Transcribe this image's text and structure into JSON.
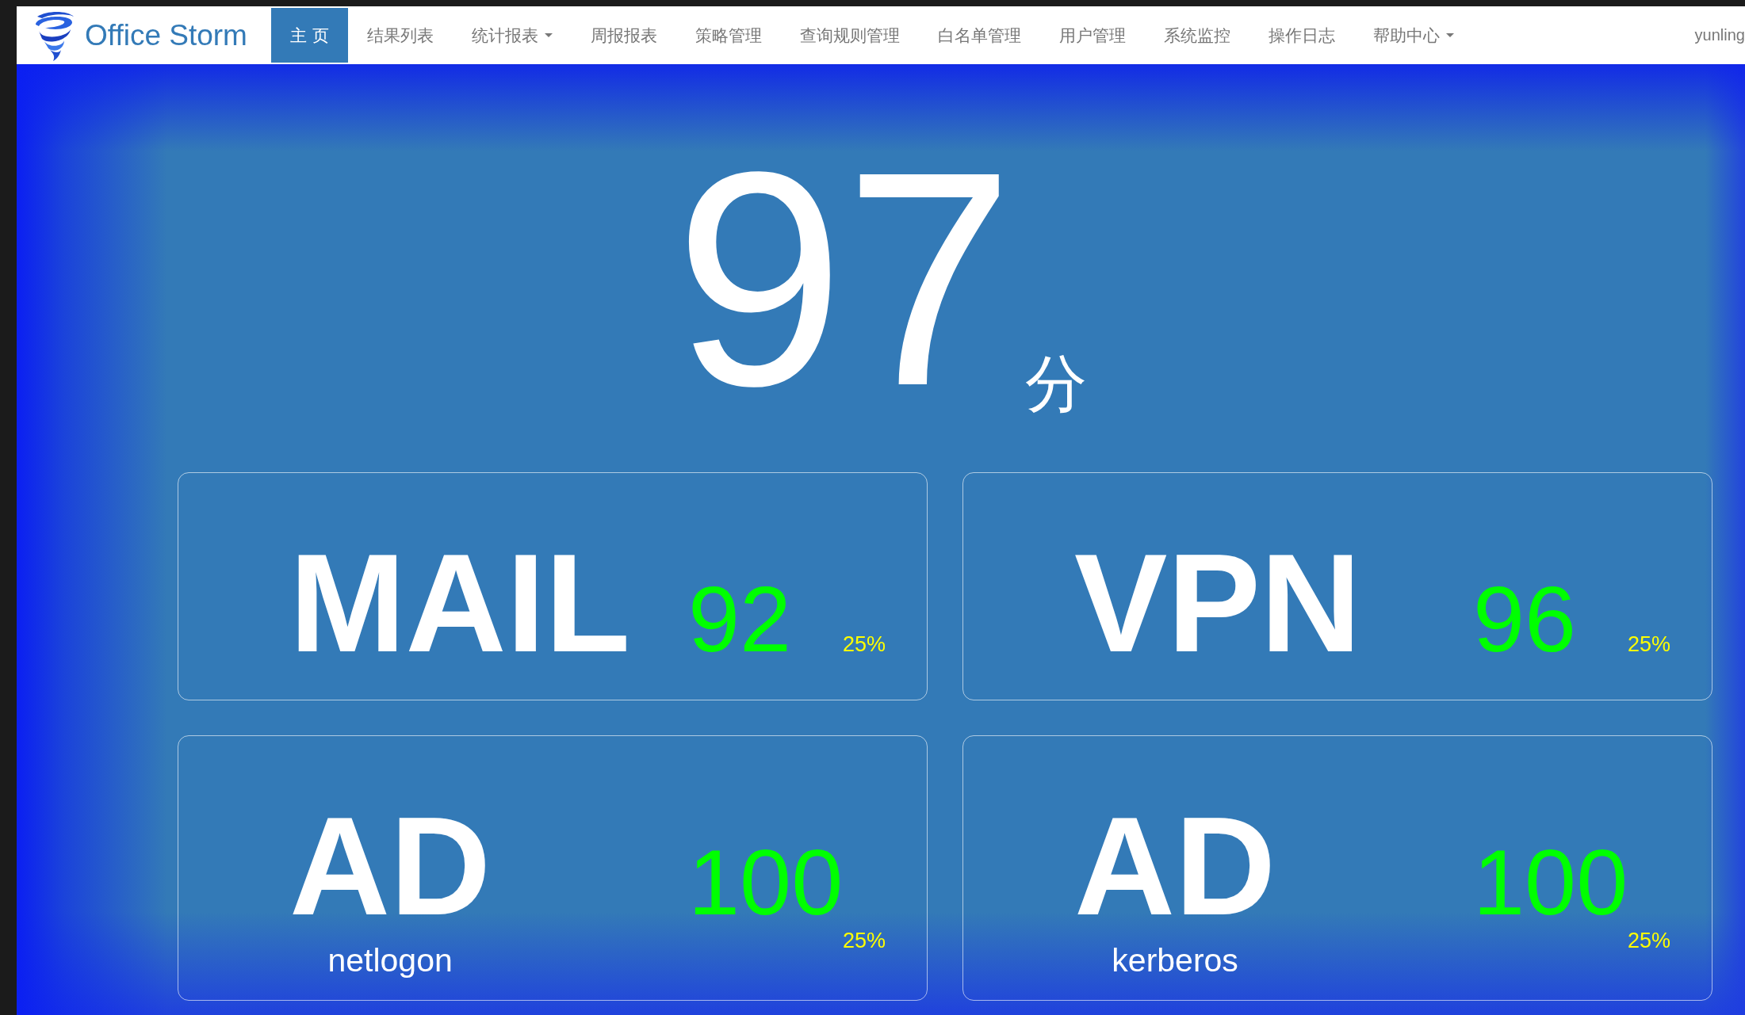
{
  "brand": {
    "name": "Office Storm"
  },
  "nav": [
    {
      "label": "主 页",
      "selected": true,
      "dropdown": false
    },
    {
      "label": "结果列表",
      "selected": false,
      "dropdown": false
    },
    {
      "label": "统计报表",
      "selected": false,
      "dropdown": true
    },
    {
      "label": "周报报表",
      "selected": false,
      "dropdown": false
    },
    {
      "label": "策略管理",
      "selected": false,
      "dropdown": false
    },
    {
      "label": "查询规则管理",
      "selected": false,
      "dropdown": false
    },
    {
      "label": "白名单管理",
      "selected": false,
      "dropdown": false
    },
    {
      "label": "用户管理",
      "selected": false,
      "dropdown": false
    },
    {
      "label": "系统监控",
      "selected": false,
      "dropdown": false
    },
    {
      "label": "操作日志",
      "selected": false,
      "dropdown": false
    },
    {
      "label": "帮助中心",
      "selected": false,
      "dropdown": true
    }
  ],
  "user": "yunling",
  "total": {
    "score": "97",
    "unit": "分"
  },
  "cards": [
    {
      "name": "MAIL",
      "score": "92",
      "weight": "25%"
    },
    {
      "name": "VPN",
      "score": "96",
      "weight": "25%"
    },
    {
      "name": "AD",
      "subtitle": "netlogon",
      "score": "100",
      "weight": "25%"
    },
    {
      "name": "AD",
      "subtitle": "kerberos",
      "score": "100",
      "weight": "25%"
    }
  ]
}
